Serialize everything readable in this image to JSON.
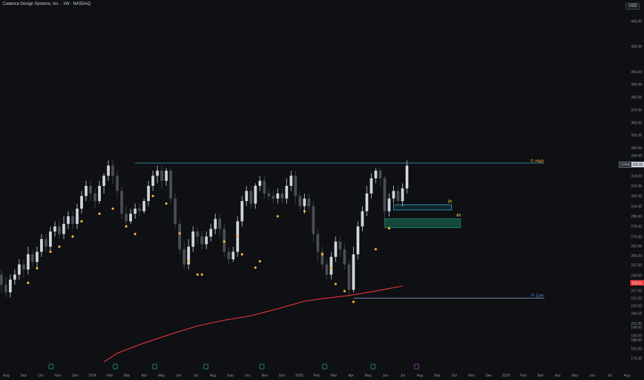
{
  "header": {
    "title": "Cadence Design Systems, Inc. · 1W · NASDAQ",
    "currency": "USD"
  },
  "colors": {
    "background": "#0e1014",
    "bull": "#d1d4dc",
    "bear": "#4a4d55",
    "marker": "#f5b82e",
    "ma": "#e5363b",
    "phigh": "#4fa8c8",
    "plow": "#9bb4d8",
    "fvg1h": "#29b6d6",
    "fvg4h": "#1f8f6a",
    "label_high": "#f5a33d",
    "label_1h": "#f5e342",
    "label_low": "#4a90e2"
  },
  "chart_data": {
    "type": "candlestick",
    "symbol": "CDNS",
    "timeframe": "1W",
    "exchange": "NASDAQ",
    "price_axis": {
      "ylim": [
        171,
        449
      ],
      "ticks": [
        174.0,
        181.5,
        188.5,
        192.0,
        198.5,
        201.5,
        209.5,
        215.5,
        221.5,
        227.5,
        233.5,
        239.5,
        247.5,
        255.0,
        262.5,
        270.0,
        278.0,
        286.0,
        294.0,
        302.0,
        310.0,
        318.0,
        326.0,
        334.0,
        340.0,
        350.0,
        360.0,
        370.0,
        380.0,
        390.0,
        400.0,
        420.0,
        440.0
      ]
    },
    "time_axis": [
      "Aug",
      "Sep",
      "Oct",
      "Nov",
      "Dec",
      "2024",
      "Feb",
      "Mar",
      "Apr",
      "May",
      "Jun",
      "Jul",
      "Aug",
      "Sep",
      "Oct",
      "Nov",
      "Dec",
      "2025",
      "Feb",
      "Mar",
      "Apr",
      "May",
      "Jun",
      "Jul",
      "Aug",
      "Sep",
      "Oct",
      "Nov",
      "Dec",
      "2026",
      "Feb",
      "Mar",
      "Apr",
      "May",
      "Jun",
      "Jul",
      "Aug"
    ],
    "candles": [
      {
        "o": 240,
        "c": 232,
        "h": 244,
        "l": 226
      },
      {
        "o": 232,
        "c": 226,
        "h": 238,
        "l": 222
      },
      {
        "o": 226,
        "c": 236,
        "h": 240,
        "l": 222
      },
      {
        "o": 236,
        "c": 240,
        "h": 244,
        "l": 232
      },
      {
        "o": 240,
        "c": 248,
        "h": 252,
        "l": 236
      },
      {
        "o": 248,
        "c": 244,
        "h": 252,
        "l": 238
      },
      {
        "o": 244,
        "c": 256,
        "h": 262,
        "l": 240
      },
      {
        "o": 256,
        "c": 250,
        "h": 260,
        "l": 246
      },
      {
        "o": 250,
        "c": 258,
        "h": 262,
        "l": 246
      },
      {
        "o": 258,
        "c": 268,
        "h": 272,
        "l": 254
      },
      {
        "o": 268,
        "c": 262,
        "h": 272,
        "l": 258
      },
      {
        "o": 262,
        "c": 274,
        "h": 278,
        "l": 258
      },
      {
        "o": 274,
        "c": 278,
        "h": 282,
        "l": 270
      },
      {
        "o": 278,
        "c": 272,
        "h": 282,
        "l": 268
      },
      {
        "o": 272,
        "c": 280,
        "h": 286,
        "l": 268
      },
      {
        "o": 280,
        "c": 286,
        "h": 290,
        "l": 276
      },
      {
        "o": 286,
        "c": 280,
        "h": 290,
        "l": 276
      },
      {
        "o": 280,
        "c": 292,
        "h": 296,
        "l": 276
      },
      {
        "o": 292,
        "c": 302,
        "h": 306,
        "l": 288
      },
      {
        "o": 302,
        "c": 310,
        "h": 314,
        "l": 298
      },
      {
        "o": 310,
        "c": 304,
        "h": 314,
        "l": 298
      },
      {
        "o": 304,
        "c": 298,
        "h": 308,
        "l": 292
      },
      {
        "o": 298,
        "c": 310,
        "h": 314,
        "l": 296
      },
      {
        "o": 310,
        "c": 318,
        "h": 320,
        "l": 304
      },
      {
        "o": 318,
        "c": 326,
        "h": 330,
        "l": 314
      },
      {
        "o": 326,
        "c": 318,
        "h": 330,
        "l": 312
      },
      {
        "o": 318,
        "c": 306,
        "h": 322,
        "l": 300
      },
      {
        "o": 306,
        "c": 288,
        "h": 310,
        "l": 284
      },
      {
        "o": 288,
        "c": 282,
        "h": 294,
        "l": 278
      },
      {
        "o": 282,
        "c": 288,
        "h": 292,
        "l": 280
      },
      {
        "o": 288,
        "c": 292,
        "h": 296,
        "l": 284
      },
      {
        "o": 292,
        "c": 290,
        "h": 296,
        "l": 286
      },
      {
        "o": 290,
        "c": 298,
        "h": 300,
        "l": 288
      },
      {
        "o": 298,
        "c": 310,
        "h": 314,
        "l": 294
      },
      {
        "o": 310,
        "c": 318,
        "h": 322,
        "l": 306
      },
      {
        "o": 318,
        "c": 322,
        "h": 326,
        "l": 312
      },
      {
        "o": 322,
        "c": 314,
        "h": 326,
        "l": 308
      },
      {
        "o": 314,
        "c": 322,
        "h": 324,
        "l": 310
      },
      {
        "o": 322,
        "c": 300,
        "h": 324,
        "l": 296
      },
      {
        "o": 300,
        "c": 280,
        "h": 304,
        "l": 276
      },
      {
        "o": 280,
        "c": 260,
        "h": 284,
        "l": 256
      },
      {
        "o": 260,
        "c": 248,
        "h": 266,
        "l": 244
      },
      {
        "o": 248,
        "c": 262,
        "h": 268,
        "l": 244
      },
      {
        "o": 262,
        "c": 274,
        "h": 278,
        "l": 258
      },
      {
        "o": 274,
        "c": 270,
        "h": 278,
        "l": 264
      },
      {
        "o": 270,
        "c": 264,
        "h": 274,
        "l": 260
      },
      {
        "o": 264,
        "c": 270,
        "h": 274,
        "l": 260
      },
      {
        "o": 270,
        "c": 276,
        "h": 280,
        "l": 266
      },
      {
        "o": 276,
        "c": 284,
        "h": 288,
        "l": 272
      },
      {
        "o": 284,
        "c": 276,
        "h": 288,
        "l": 270
      },
      {
        "o": 276,
        "c": 258,
        "h": 280,
        "l": 254
      },
      {
        "o": 258,
        "c": 252,
        "h": 262,
        "l": 248
      },
      {
        "o": 252,
        "c": 258,
        "h": 262,
        "l": 250
      },
      {
        "o": 258,
        "c": 282,
        "h": 286,
        "l": 254
      },
      {
        "o": 282,
        "c": 298,
        "h": 302,
        "l": 278
      },
      {
        "o": 298,
        "c": 306,
        "h": 310,
        "l": 294
      },
      {
        "o": 306,
        "c": 296,
        "h": 310,
        "l": 292
      },
      {
        "o": 296,
        "c": 310,
        "h": 312,
        "l": 292
      },
      {
        "o": 310,
        "c": 314,
        "h": 318,
        "l": 306
      },
      {
        "o": 314,
        "c": 304,
        "h": 318,
        "l": 300
      },
      {
        "o": 304,
        "c": 302,
        "h": 308,
        "l": 298
      },
      {
        "o": 302,
        "c": 300,
        "h": 306,
        "l": 296
      },
      {
        "o": 300,
        "c": 304,
        "h": 308,
        "l": 296
      },
      {
        "o": 304,
        "c": 300,
        "h": 308,
        "l": 296
      },
      {
        "o": 300,
        "c": 310,
        "h": 316,
        "l": 296
      },
      {
        "o": 310,
        "c": 318,
        "h": 322,
        "l": 306
      },
      {
        "o": 318,
        "c": 302,
        "h": 322,
        "l": 296
      },
      {
        "o": 302,
        "c": 294,
        "h": 306,
        "l": 290
      },
      {
        "o": 294,
        "c": 300,
        "h": 304,
        "l": 288
      },
      {
        "o": 300,
        "c": 294,
        "h": 304,
        "l": 290
      },
      {
        "o": 294,
        "c": 272,
        "h": 298,
        "l": 266
      },
      {
        "o": 272,
        "c": 258,
        "h": 276,
        "l": 250
      },
      {
        "o": 258,
        "c": 248,
        "h": 262,
        "l": 244
      },
      {
        "o": 248,
        "c": 240,
        "h": 252,
        "l": 236
      },
      {
        "o": 240,
        "c": 254,
        "h": 258,
        "l": 236
      },
      {
        "o": 254,
        "c": 266,
        "h": 270,
        "l": 250
      },
      {
        "o": 266,
        "c": 260,
        "h": 270,
        "l": 254
      },
      {
        "o": 260,
        "c": 248,
        "h": 264,
        "l": 244
      },
      {
        "o": 248,
        "c": 228,
        "h": 252,
        "l": 222
      },
      {
        "o": 228,
        "c": 256,
        "h": 262,
        "l": 226
      },
      {
        "o": 256,
        "c": 278,
        "h": 282,
        "l": 252
      },
      {
        "o": 278,
        "c": 290,
        "h": 294,
        "l": 274
      },
      {
        "o": 290,
        "c": 304,
        "h": 310,
        "l": 286
      },
      {
        "o": 304,
        "c": 316,
        "h": 320,
        "l": 300
      },
      {
        "o": 316,
        "c": 322,
        "h": 324,
        "l": 312
      },
      {
        "o": 322,
        "c": 316,
        "h": 324,
        "l": 310
      },
      {
        "o": 316,
        "c": 290,
        "h": 318,
        "l": 284
      },
      {
        "o": 290,
        "c": 300,
        "h": 304,
        "l": 286
      },
      {
        "o": 300,
        "c": 306,
        "h": 310,
        "l": 296
      },
      {
        "o": 306,
        "c": 298,
        "h": 310,
        "l": 294
      },
      {
        "o": 298,
        "c": 308,
        "h": 312,
        "l": 294
      },
      {
        "o": 308,
        "c": 326,
        "h": 330,
        "l": 304
      }
    ],
    "swing_markers": [
      {
        "i": 6,
        "price": 233.5
      },
      {
        "i": 8,
        "price": 245.0
      },
      {
        "i": 11,
        "price": 258.0
      },
      {
        "i": 13,
        "price": 262.0
      },
      {
        "i": 16,
        "price": 270.0
      },
      {
        "i": 18,
        "price": 282.0
      },
      {
        "i": 22,
        "price": 288.0
      },
      {
        "i": 25,
        "price": 292.0
      },
      {
        "i": 28,
        "price": 278.0
      },
      {
        "i": 30,
        "price": 272.0
      },
      {
        "i": 34,
        "price": 302.0
      },
      {
        "i": 37,
        "price": 296.0
      },
      {
        "i": 40,
        "price": 272.5
      },
      {
        "i": 42,
        "price": 250.5
      },
      {
        "i": 44,
        "price": 240.0
      },
      {
        "i": 45,
        "price": 240.0
      },
      {
        "i": 50,
        "price": 266.0
      },
      {
        "i": 53,
        "price": 270.0
      },
      {
        "i": 54,
        "price": 256.0
      },
      {
        "i": 57,
        "price": 245.5
      },
      {
        "i": 58,
        "price": 250.5
      },
      {
        "i": 62,
        "price": 286.0
      },
      {
        "i": 68,
        "price": 290.0
      },
      {
        "i": 72,
        "price": 256.0
      },
      {
        "i": 74,
        "price": 245.5
      },
      {
        "i": 75,
        "price": 232.5
      },
      {
        "i": 77,
        "price": 227.0
      },
      {
        "i": 79,
        "price": 218.5
      },
      {
        "i": 84,
        "price": 260.0
      },
      {
        "i": 87,
        "price": 276.5
      }
    ],
    "ma_200": [
      {
        "i": 23,
        "v": 171.0
      },
      {
        "i": 26,
        "v": 178.0
      },
      {
        "i": 32,
        "v": 186.0
      },
      {
        "i": 38,
        "v": 193.0
      },
      {
        "i": 44,
        "v": 199.5
      },
      {
        "i": 50,
        "v": 204.0
      },
      {
        "i": 56,
        "v": 207.5
      },
      {
        "i": 62,
        "v": 213.0
      },
      {
        "i": 68,
        "v": 219.0
      },
      {
        "i": 72,
        "v": 221.0
      },
      {
        "i": 78,
        "v": 223.5
      },
      {
        "i": 84,
        "v": 227.0
      },
      {
        "i": 90,
        "v": 231.0
      }
    ],
    "levels": {
      "p_high": {
        "label": "P. High",
        "price": 328.0,
        "from_i": 30
      },
      "p_low": {
        "label": "P. Low",
        "price": 221.5,
        "from_i": 79
      }
    },
    "zones": [
      {
        "label": "1h",
        "top": 295.0,
        "bottom": 291.0,
        "from_i": 88,
        "to_i": 101
      },
      {
        "label": "4h",
        "top": 284.0,
        "bottom": 277.0,
        "from_i": 86,
        "to_i": 103
      }
    ],
    "price_tags": [
      {
        "symbol": "CDNS",
        "value": "326.81",
        "price": 326.81
      },
      {
        "symbol": "",
        "value": "233.51",
        "price": 233.51
      }
    ],
    "event_markers_x": [
      1,
      14,
      25,
      36,
      47,
      60,
      72,
      84
    ],
    "current_month_marker_x": 95
  }
}
